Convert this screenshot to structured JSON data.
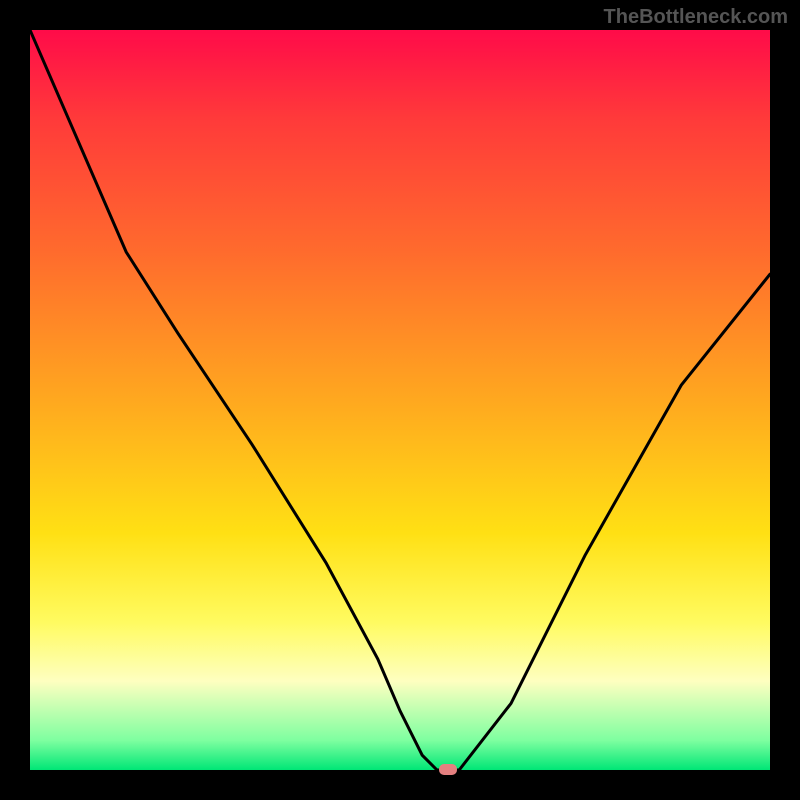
{
  "watermark": "TheBottleneck.com",
  "chart_data": {
    "type": "line",
    "title": "",
    "xlabel": "",
    "ylabel": "",
    "xlim": [
      0,
      100
    ],
    "ylim": [
      0,
      100
    ],
    "series": [
      {
        "name": "curve",
        "x": [
          0,
          13,
          20,
          30,
          40,
          47,
          50,
          53,
          55,
          58,
          65,
          75,
          88,
          100
        ],
        "values": [
          100,
          70,
          59,
          44,
          28,
          15,
          8,
          2,
          0,
          0,
          9,
          29,
          52,
          67
        ]
      }
    ],
    "marker": {
      "x": 56.5,
      "y": 0,
      "color": "#e48080"
    },
    "gradient_stops": [
      {
        "pos": 0,
        "color": "#ff0b49"
      },
      {
        "pos": 50,
        "color": "#ffa81f"
      },
      {
        "pos": 88,
        "color": "#feffc0"
      },
      {
        "pos": 100,
        "color": "#00e676"
      }
    ]
  }
}
